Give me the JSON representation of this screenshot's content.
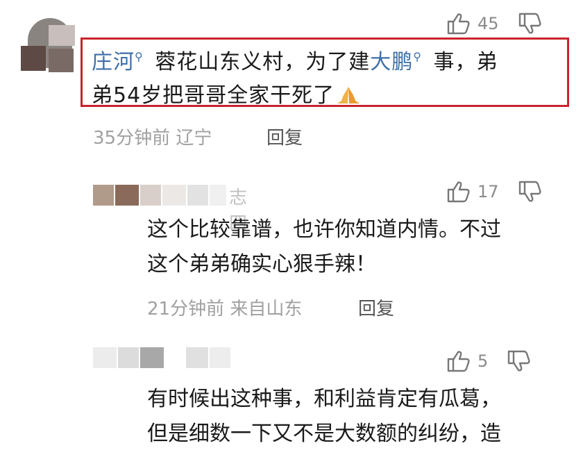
{
  "comments": [
    {
      "likes": "45",
      "parts": {
        "l1a": "庄河",
        "l1b": " 蓉花山东义村，为了建",
        "l1c": "大鹏",
        "l1d": " 事，弟",
        "l2": "弟54岁把哥哥全家干死了"
      },
      "time_location": "35分钟前 辽宁",
      "reply_label": "回复"
    },
    {
      "username_partial": "志四",
      "likes": "17",
      "line1": "这个比较靠谱，也许你知道内情。不过",
      "line2": "这个弟弟确实心狠手辣！",
      "time_location": "21分钟前 来自山东",
      "reply_label": "回复"
    },
    {
      "likes": "5",
      "line1": "有时候出这种事，和利益肯定有瓜葛，",
      "line2": "但是细数一下又不是大数额的纠纷，造"
    }
  ],
  "icons": {
    "like": "thumbs-up-icon",
    "dislike": "thumbs-down-icon",
    "search": "search-icon",
    "emoji": "praying-hands-emoji"
  },
  "colors": {
    "link": "#3d6fa8",
    "highlight_border": "#c8232c",
    "meta": "#a0a0a0"
  }
}
